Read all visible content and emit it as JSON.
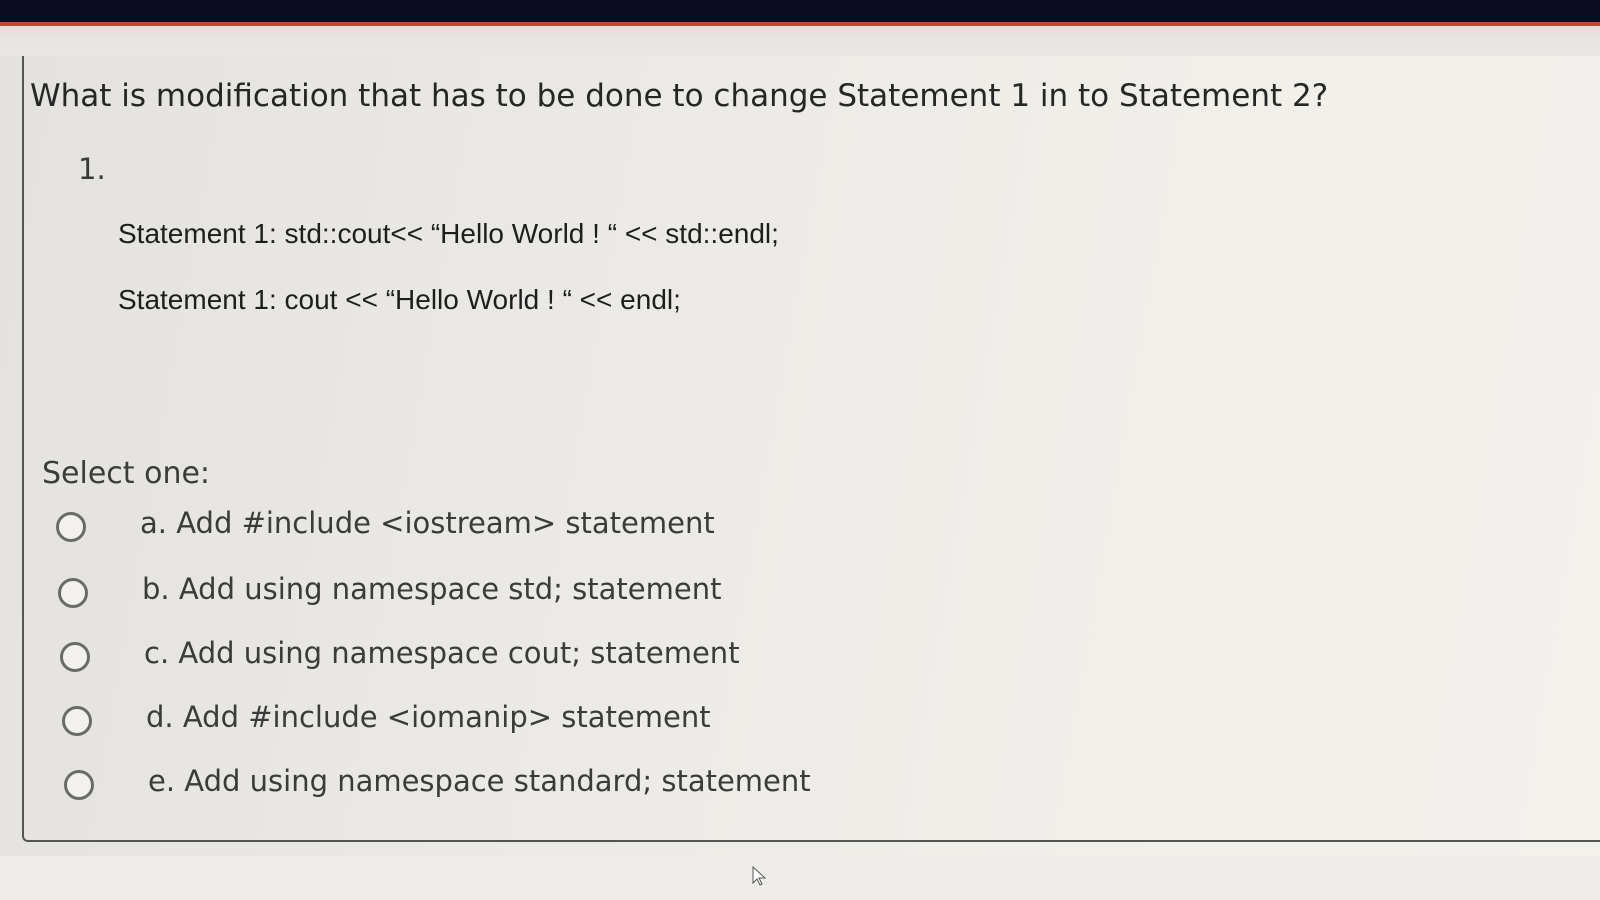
{
  "question": {
    "text": "What is modification that has to be done to change Statement 1 in to Statement 2?",
    "number": "1.",
    "statements": [
      "Statement 1: std::cout<< “Hello World ! “ << std::endl;",
      "Statement 1: cout << “Hello World ! “ << endl;"
    ]
  },
  "answer": {
    "select_label": "Select one:",
    "options": [
      "a. Add #include <iostream> statement",
      "b. Add using namespace std; statement",
      "c. Add using namespace cout; statement",
      "d. Add #include <iomanip> statement",
      "e. Add using namespace standard; statement"
    ]
  },
  "icons": {
    "radio": "radio-unselected-icon",
    "cursor": "mouse-pointer-icon"
  },
  "colors": {
    "top_bar": "#0b0b24",
    "accent": "#c9432c",
    "background": "#e9e7e2"
  }
}
